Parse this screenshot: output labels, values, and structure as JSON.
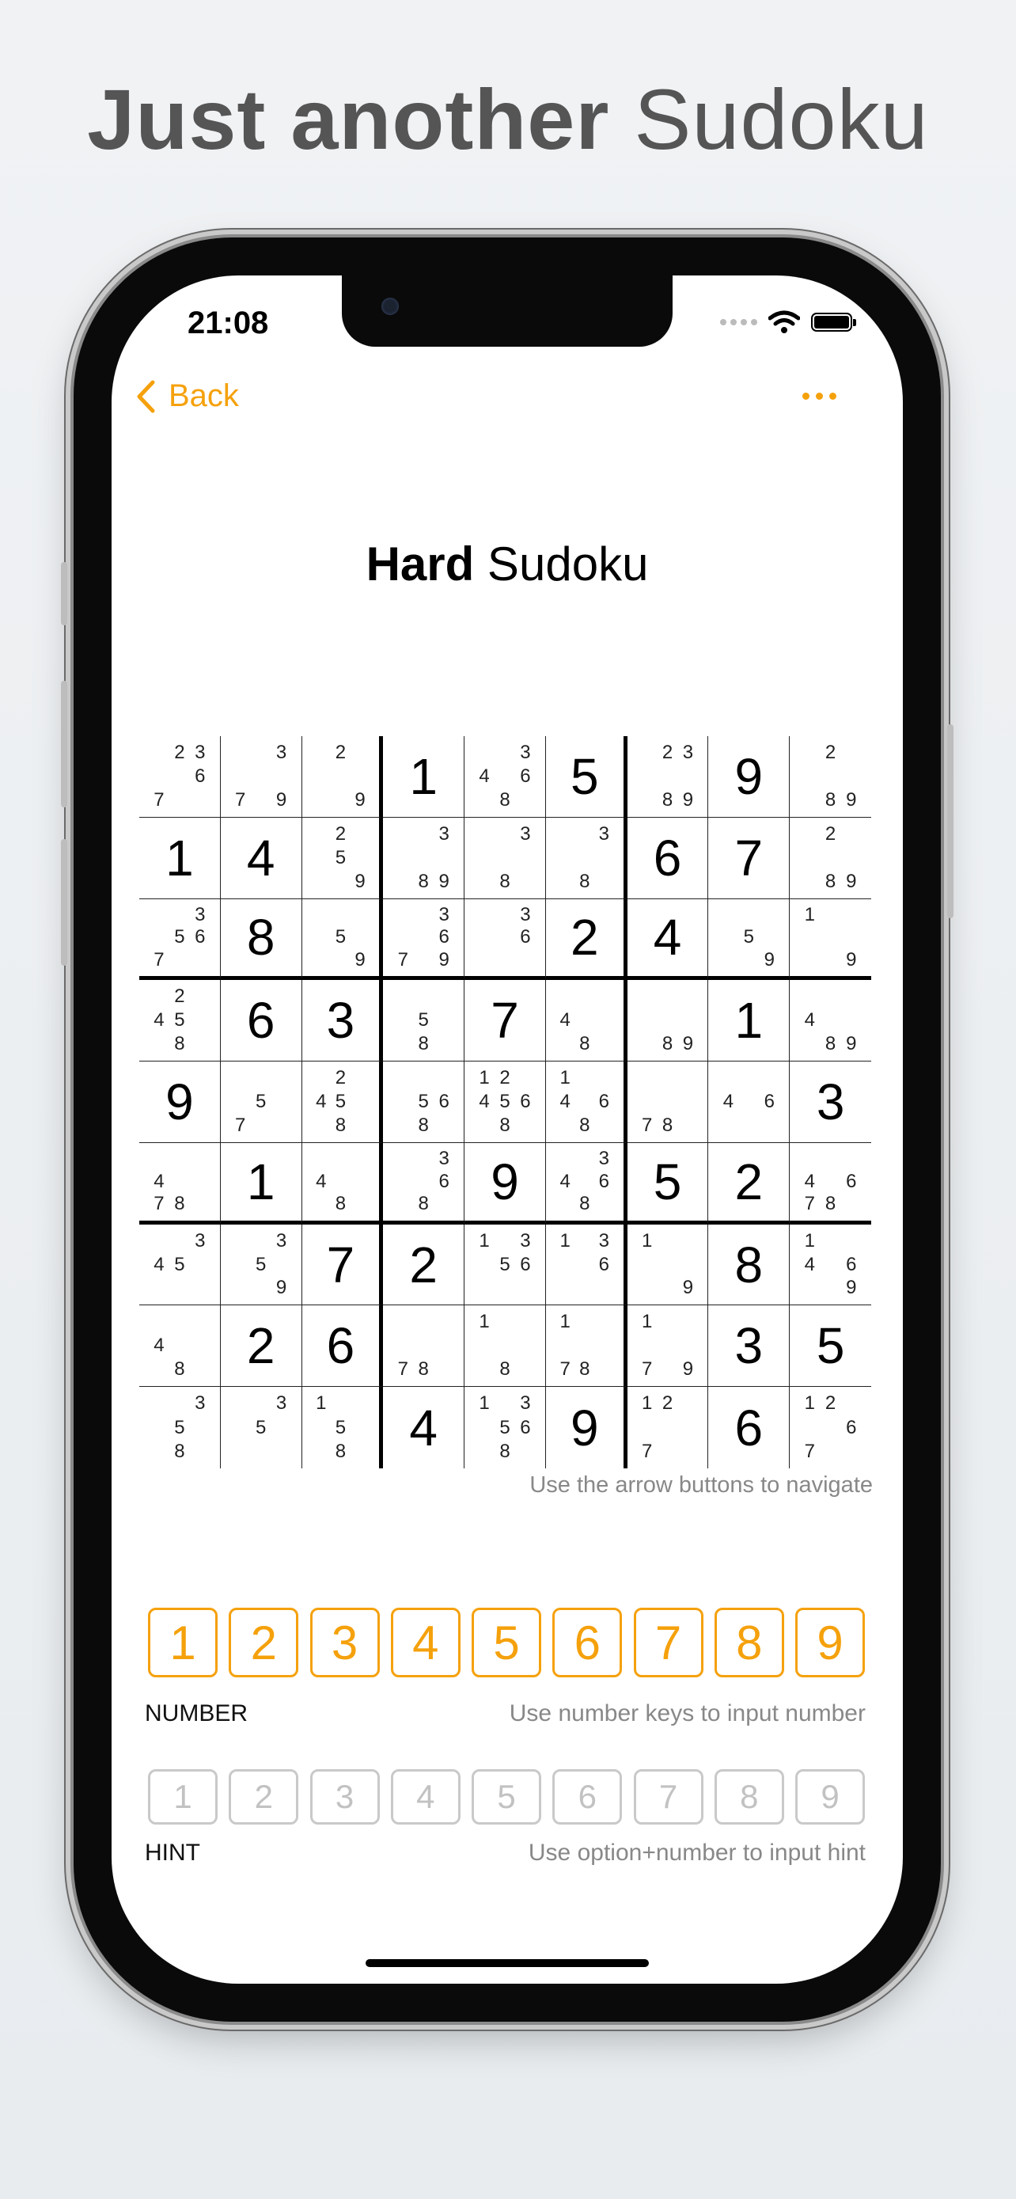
{
  "headline": {
    "bold": "Just another",
    "light": " Sudoku"
  },
  "status_bar": {
    "time": "21:08"
  },
  "nav": {
    "back_label": "Back",
    "more_icon": "ellipsis-icon"
  },
  "title": {
    "bold": "Hard",
    "light": " Sudoku"
  },
  "colors": {
    "accent": "#f5a10c",
    "hint_border": "#c9c9c9"
  },
  "grid": {
    "cells": [
      {
        "candidates": [
          "2",
          "3",
          "6",
          "7"
        ]
      },
      {
        "candidates": [
          "3",
          "7",
          "9"
        ]
      },
      {
        "candidates": [
          "2",
          "9"
        ]
      },
      {
        "value": "1"
      },
      {
        "candidates": [
          "3",
          "4",
          "6",
          "8"
        ]
      },
      {
        "value": "5"
      },
      {
        "candidates": [
          "2",
          "3",
          "8",
          "9"
        ]
      },
      {
        "value": "9"
      },
      {
        "candidates": [
          "2",
          "8",
          "9"
        ]
      },
      {
        "value": "1"
      },
      {
        "value": "4"
      },
      {
        "candidates": [
          "2",
          "5",
          "9"
        ]
      },
      {
        "candidates": [
          "3",
          "8",
          "9"
        ]
      },
      {
        "candidates": [
          "3",
          "8"
        ]
      },
      {
        "candidates": [
          "3",
          "8"
        ]
      },
      {
        "value": "6"
      },
      {
        "value": "7"
      },
      {
        "candidates": [
          "2",
          "8",
          "9"
        ]
      },
      {
        "candidates": [
          "3",
          "5",
          "6",
          "7"
        ]
      },
      {
        "value": "8"
      },
      {
        "candidates": [
          "5",
          "9"
        ]
      },
      {
        "candidates": [
          "3",
          "6",
          "7",
          "9"
        ]
      },
      {
        "candidates": [
          "3",
          "6"
        ]
      },
      {
        "value": "2"
      },
      {
        "value": "4"
      },
      {
        "candidates": [
          "5",
          "9"
        ]
      },
      {
        "candidates": [
          "1",
          "9"
        ]
      },
      {
        "candidates": [
          "2",
          "4",
          "5",
          "8"
        ]
      },
      {
        "value": "6"
      },
      {
        "value": "3"
      },
      {
        "candidates": [
          "5",
          "8"
        ]
      },
      {
        "value": "7"
      },
      {
        "candidates": [
          "4",
          "8"
        ]
      },
      {
        "candidates": [
          "8",
          "9"
        ]
      },
      {
        "value": "1"
      },
      {
        "candidates": [
          "4",
          "8",
          "9"
        ]
      },
      {
        "value": "9"
      },
      {
        "candidates": [
          "5",
          "7"
        ]
      },
      {
        "candidates": [
          "2",
          "4",
          "5",
          "8"
        ]
      },
      {
        "candidates": [
          "5",
          "6",
          "8"
        ]
      },
      {
        "candidates": [
          "1",
          "2",
          "4",
          "5",
          "6",
          "8"
        ]
      },
      {
        "candidates": [
          "1",
          "4",
          "6",
          "8"
        ]
      },
      {
        "candidates": [
          "7",
          "8"
        ]
      },
      {
        "candidates": [
          "4",
          "6"
        ]
      },
      {
        "value": "3"
      },
      {
        "candidates": [
          "4",
          "7",
          "8"
        ]
      },
      {
        "value": "1"
      },
      {
        "candidates": [
          "4",
          "8"
        ]
      },
      {
        "candidates": [
          "3",
          "6",
          "8"
        ]
      },
      {
        "value": "9"
      },
      {
        "candidates": [
          "3",
          "4",
          "6",
          "8"
        ]
      },
      {
        "value": "5"
      },
      {
        "value": "2"
      },
      {
        "candidates": [
          "4",
          "6",
          "7",
          "8"
        ]
      },
      {
        "candidates": [
          "3",
          "4",
          "5"
        ]
      },
      {
        "candidates": [
          "3",
          "5",
          "9"
        ]
      },
      {
        "value": "7"
      },
      {
        "value": "2"
      },
      {
        "candidates": [
          "1",
          "3",
          "5",
          "6"
        ]
      },
      {
        "candidates": [
          "1",
          "3",
          "6"
        ]
      },
      {
        "candidates": [
          "1",
          "9"
        ]
      },
      {
        "value": "8"
      },
      {
        "candidates": [
          "1",
          "4",
          "6",
          "9"
        ]
      },
      {
        "candidates": [
          "4",
          "8"
        ]
      },
      {
        "value": "2"
      },
      {
        "value": "6"
      },
      {
        "candidates": [
          "7",
          "8"
        ]
      },
      {
        "candidates": [
          "1",
          "8"
        ]
      },
      {
        "candidates": [
          "1",
          "7",
          "8"
        ]
      },
      {
        "candidates": [
          "1",
          "7",
          "9"
        ]
      },
      {
        "value": "3"
      },
      {
        "value": "5"
      },
      {
        "candidates": [
          "3",
          "5",
          "8"
        ]
      },
      {
        "candidates": [
          "3",
          "5"
        ]
      },
      {
        "candidates": [
          "1",
          "5",
          "8"
        ]
      },
      {
        "value": "4"
      },
      {
        "candidates": [
          "1",
          "3",
          "5",
          "6",
          "8"
        ]
      },
      {
        "value": "9"
      },
      {
        "candidates": [
          "1",
          "2",
          "7"
        ]
      },
      {
        "value": "6"
      },
      {
        "candidates": [
          "1",
          "2",
          "6",
          "7"
        ]
      }
    ],
    "help": "Use the arrow buttons to navigate"
  },
  "number_pad": {
    "keys": [
      "1",
      "2",
      "3",
      "4",
      "5",
      "6",
      "7",
      "8",
      "9"
    ],
    "label": "NUMBER",
    "help": "Use number keys to input number"
  },
  "hint_pad": {
    "keys": [
      "1",
      "2",
      "3",
      "4",
      "5",
      "6",
      "7",
      "8",
      "9"
    ],
    "label": "HINT",
    "help": "Use option+number to input hint"
  }
}
